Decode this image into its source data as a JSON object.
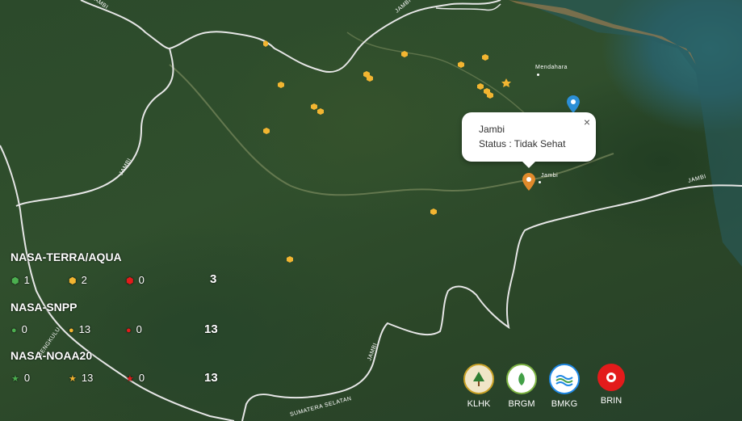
{
  "map": {
    "place_labels": [
      "Mendahara",
      "Jambi"
    ],
    "road_labels": [
      "JAMBI",
      "JAMBI",
      "JAMBI",
      "JAMBI",
      "SUMATERA SELATAN",
      "BENGKULU"
    ],
    "colors": {
      "hotspot_medium": "#f2b531",
      "hotspot_low": "#4caf50",
      "hotspot_high": "#e31b1b",
      "marker_orange": "#e08a2c",
      "marker_blue": "#2b8fd6",
      "boundary": "#e6e6e6"
    }
  },
  "popup": {
    "name": "Jambi",
    "status": "Status : Tidak Sehat",
    "close_icon": "close-icon"
  },
  "legend": {
    "groups": [
      {
        "title": "NASA-TERRA/AQUA",
        "icon": "hexagon",
        "low": "1",
        "medium": "2",
        "high": "0",
        "total": "3"
      },
      {
        "title": "NASA-SNPP",
        "icon": "circle",
        "low": "0",
        "medium": "13",
        "high": "0",
        "total": "13"
      },
      {
        "title": "NASA-NOAA20",
        "icon": "star",
        "low": "0",
        "medium": "13",
        "high": "0",
        "total": "13"
      }
    ]
  },
  "logos": [
    {
      "label": "KLHK"
    },
    {
      "label": "BRGM"
    },
    {
      "label": "BMKG"
    },
    {
      "label": "BRIN"
    }
  ]
}
